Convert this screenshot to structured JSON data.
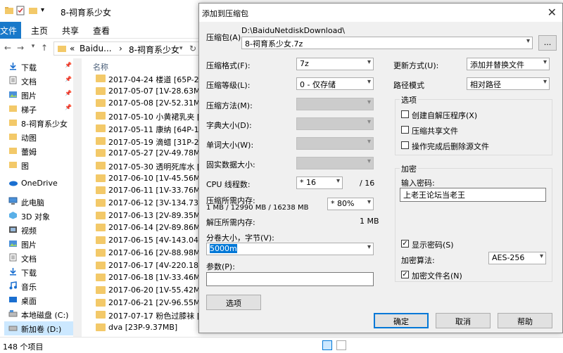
{
  "explorer": {
    "title": "8-祠育系少女",
    "ribbon_tabs": [
      "文件",
      "主页",
      "共享",
      "查看"
    ],
    "breadcrumb": [
      "«",
      "Baidu...",
      "›",
      "8-祠育系少女"
    ],
    "nav_items": [
      {
        "label": "下载",
        "pinned": true
      },
      {
        "label": "文档",
        "pinned": true
      },
      {
        "label": "图片",
        "pinned": true
      },
      {
        "label": "梯子",
        "pinned": true
      },
      {
        "label": "8-祠育系少女",
        "pinned": false
      },
      {
        "label": "动图",
        "pinned": false
      },
      {
        "label": "蕾姆",
        "pinned": false
      },
      {
        "label": "图",
        "pinned": false
      },
      {
        "label": "OneDrive",
        "pinned": false
      },
      {
        "label": "此电脑",
        "pinned": false
      },
      {
        "label": "3D 对象",
        "pinned": false
      },
      {
        "label": "视频",
        "pinned": false
      },
      {
        "label": "图片",
        "pinned": false
      },
      {
        "label": "文档",
        "pinned": false
      },
      {
        "label": "下载",
        "pinned": false
      },
      {
        "label": "音乐",
        "pinned": false
      },
      {
        "label": "桌面",
        "pinned": false
      },
      {
        "label": "本地磁盘 (C:)",
        "pinned": false
      },
      {
        "label": "新加卷 (D:)",
        "pinned": false
      }
    ],
    "column_header": "名称",
    "files": [
      "2017-04-24 楼道 [65P-290.8",
      "2017-05-07 [1V-28.63MB]",
      "2017-05-08 [2V-52.31MB]",
      "2017-05-10 小黄裙乳夹 [22P",
      "2017-05-11 康纳 [64P-1V-30",
      "2017-05-19 滴蜡 [31P-2V-11",
      "2017-05-27 [2V-49.78MB]",
      "2017-05-30 透明死库水 [46P",
      "2017-06-10 [1V-45.56MB]",
      "2017-06-11 [1V-33.76MB]",
      "2017-06-12 [3V-134.73MB]",
      "2017-06-13 [2V-89.35MB]",
      "2017-06-14 [2V-89.86MB]",
      "2017-06-15 [4V-143.04MB]",
      "2017-06-16 [2V-88.98MB]",
      "2017-06-17 [4V-220.18MB]",
      "2017-06-18 [1V-33.46MB]",
      "2017-06-20 [1V-55.42MB]",
      "2017-06-21 [2V-96.55MB]",
      "2017-07-17 粉色过膝袜 [44P",
      "dva [23P-9.37MB]"
    ],
    "status": "148 个项目"
  },
  "dialog": {
    "title": "添加到压缩包",
    "archive_label": "压缩包(A)",
    "archive_path": "D:\\BaiduNetdiskDownload\\",
    "archive_name": "8-祠育系少女.7z",
    "browse_label": "...",
    "format_label": "压缩格式(F):",
    "format_value": "7z",
    "level_label": "压缩等级(L):",
    "level_value": "0 - 仅存储",
    "method_label": "压缩方法(M):",
    "dict_label": "字典大小(D):",
    "word_label": "单词大小(W):",
    "solid_label": "固实数据大小:",
    "threads_label": "CPU 线程数:",
    "threads_value": "16",
    "threads_max": "/ 16",
    "mem_compress_label": "压缩所需内存:",
    "mem_compress_value": "1 MB / 12990 MB / 16238 MB",
    "mem_percent_value": "80%",
    "mem_decompress_label": "解压所需内存:",
    "mem_decompress_value": "1 MB",
    "split_label": "分卷大小，字节(V):",
    "split_value": "5000m",
    "params_label": "参数(P):",
    "params_value": "",
    "options_button": "选项",
    "update_label": "更新方式(U):",
    "update_value": "添加并替换文件",
    "path_label": "路径模式",
    "path_value": "相对路径",
    "options_group": "选项",
    "opt_sfx": "创建自解压程序(X)",
    "opt_shared": "压缩共享文件",
    "opt_delete": "操作完成后删除源文件",
    "encrypt_group": "加密",
    "password_label": "输入密码:",
    "password_value": "上老王论坛当老王",
    "show_password": "显示密码(S)",
    "enc_method_label": "加密算法:",
    "enc_method_value": "AES-256",
    "enc_names": "加密文件名(N)",
    "ok": "确定",
    "cancel": "取消",
    "help": "帮助"
  },
  "colors": {
    "accent": "#0078d7",
    "folder": "#f3c969",
    "ribbon_file": "#1979ca"
  }
}
